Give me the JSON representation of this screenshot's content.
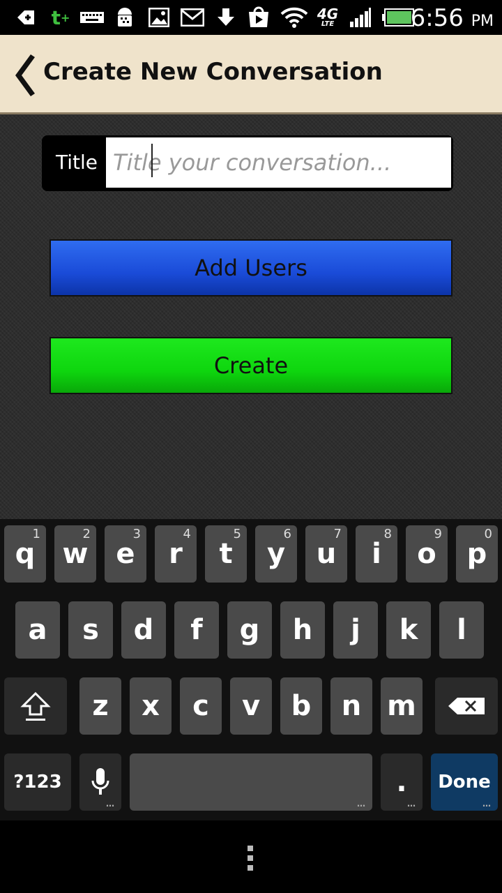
{
  "status_bar": {
    "time": "6:56",
    "ampm": "PM",
    "network": "4G",
    "network_sub": "LTE",
    "icons": [
      "add-icon",
      "tmobile-plus-icon",
      "keyboard-icon",
      "android-debug-icon",
      "gallery-icon",
      "gmail-icon",
      "download-icon",
      "play-store-icon",
      "wifi-icon",
      "4g-lte-icon",
      "signal-icon",
      "battery-icon"
    ]
  },
  "action_bar": {
    "title": "Create New Conversation",
    "background": "#efe3cb"
  },
  "form": {
    "title_label": "Title",
    "title_placeholder": "Title your conversation...",
    "add_users_label": "Add Users",
    "create_label": "Create",
    "add_users_color": "#1f55e0",
    "create_color": "#0ed60e"
  },
  "keyboard": {
    "row1": [
      {
        "key": "q",
        "num": "1"
      },
      {
        "key": "w",
        "num": "2"
      },
      {
        "key": "e",
        "num": "3"
      },
      {
        "key": "r",
        "num": "4"
      },
      {
        "key": "t",
        "num": "5"
      },
      {
        "key": "y",
        "num": "6"
      },
      {
        "key": "u",
        "num": "7"
      },
      {
        "key": "i",
        "num": "8"
      },
      {
        "key": "o",
        "num": "9"
      },
      {
        "key": "p",
        "num": "0"
      }
    ],
    "row2": [
      "a",
      "s",
      "d",
      "f",
      "g",
      "h",
      "j",
      "k",
      "l"
    ],
    "row3": [
      "z",
      "x",
      "c",
      "v",
      "b",
      "n",
      "m"
    ],
    "symbols_label": "?123",
    "period_label": ".",
    "done_label": "Done"
  }
}
